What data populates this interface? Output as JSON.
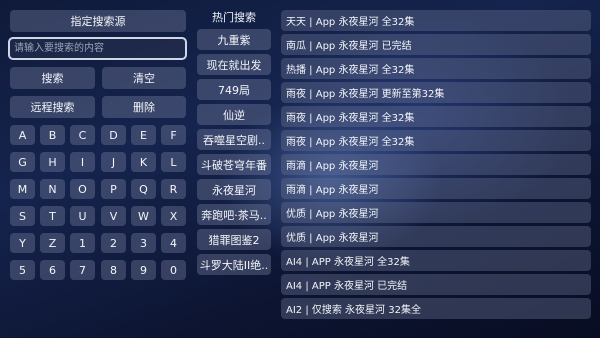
{
  "left": {
    "source_button": "指定搜索源",
    "search_placeholder": "请输入要搜索的内容",
    "search_button": "搜索",
    "clear_button": "清空",
    "remote_search_button": "远程搜索",
    "delete_button": "删除",
    "keys": [
      "A",
      "B",
      "C",
      "D",
      "E",
      "F",
      "G",
      "H",
      "I",
      "J",
      "K",
      "L",
      "M",
      "N",
      "O",
      "P",
      "Q",
      "R",
      "S",
      "T",
      "U",
      "V",
      "W",
      "X",
      "Y",
      "Z",
      "1",
      "2",
      "3",
      "4",
      "5",
      "6",
      "7",
      "8",
      "9",
      "0"
    ]
  },
  "hot": {
    "title": "热门搜索",
    "items": [
      "九重紫",
      "现在就出发",
      "749局",
      "仙逆",
      "吞噬星空剧..",
      "斗破苍穹年番",
      "永夜星河",
      "奔跑吧·茶马..",
      "猎罪图鉴2",
      "斗罗大陆II绝.."
    ]
  },
  "results": [
    "天天 | App  永夜星河  全32集",
    "南瓜 | App  永夜星河  已完结",
    "热播 | App  永夜星河  全32集",
    "雨夜 | App  永夜星河  更新至第32集",
    "雨夜 | App  永夜星河  全32集",
    "雨夜 | App  永夜星河  全32集",
    "雨滴 | App  永夜星河",
    "雨滴 | App  永夜星河",
    "优质 | App  永夜星河",
    "优质 | App  永夜星河",
    "AI4 | APP  永夜星河  全32集",
    "AI4 | APP  永夜星河  已完结",
    "AI2 | 仅搜索  永夜星河  32集全"
  ]
}
